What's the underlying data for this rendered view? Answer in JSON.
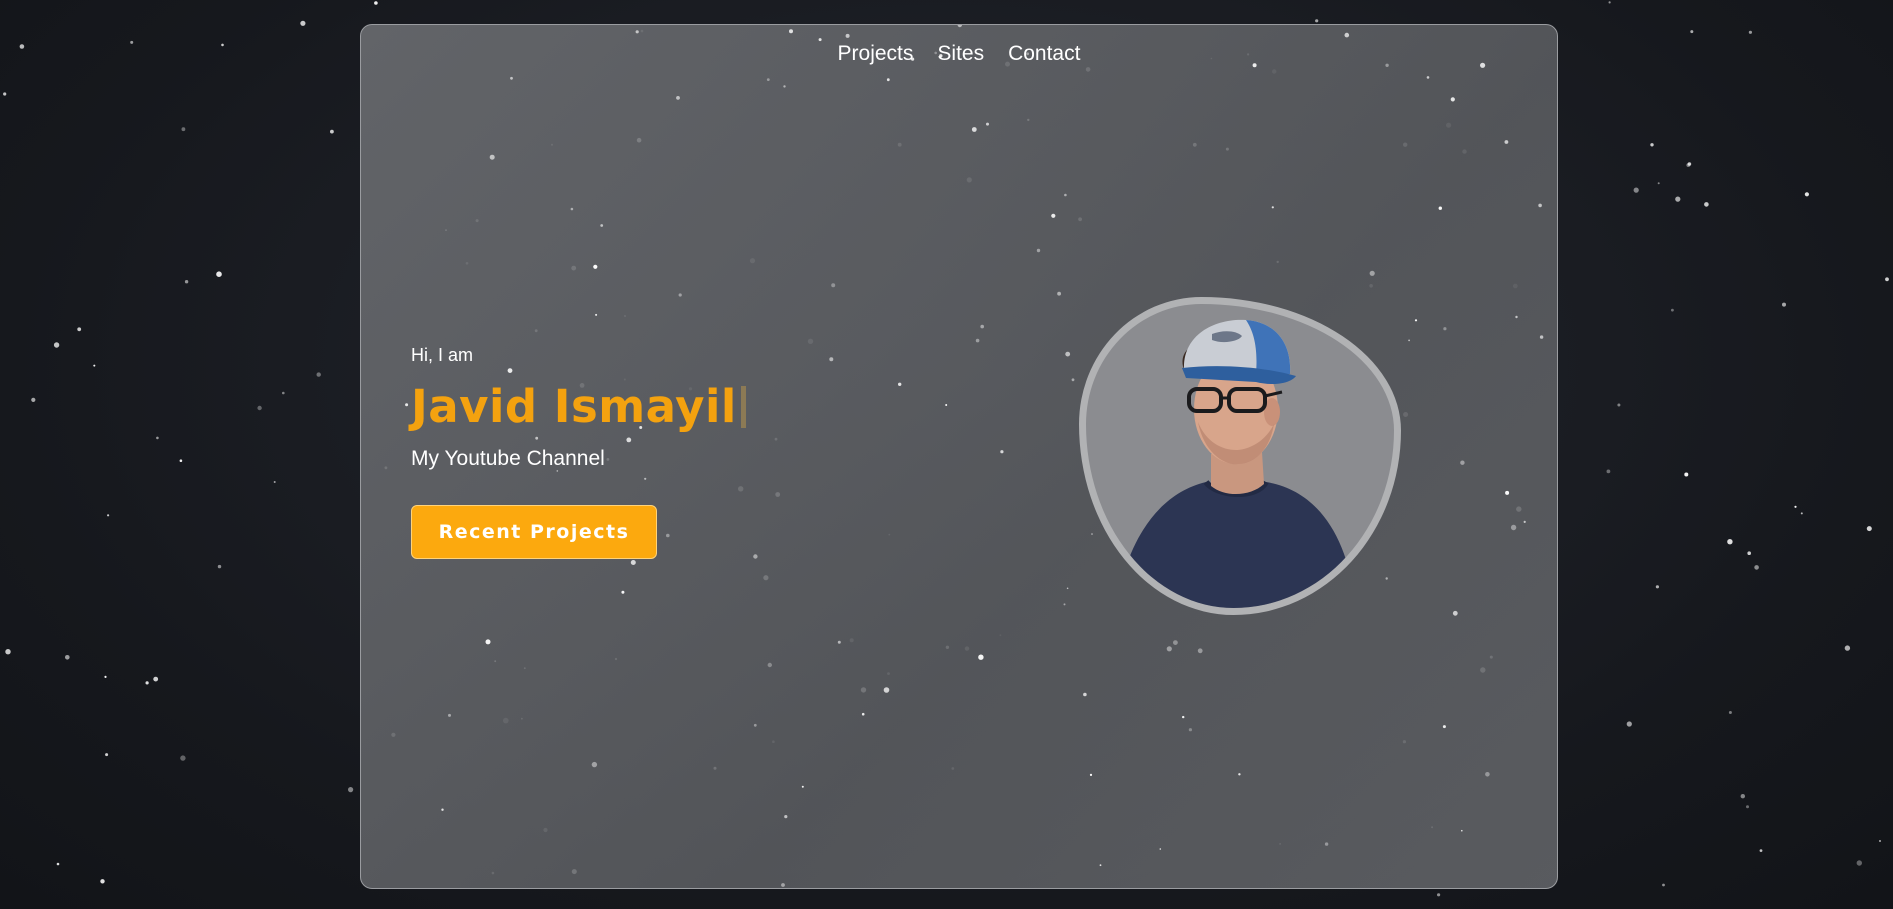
{
  "nav": {
    "items": [
      "Projects",
      "Sites",
      "Contact"
    ]
  },
  "hero": {
    "greeting": "Hi, I am",
    "name": "Javid Ismayil",
    "subtitle": "My Youtube Channel",
    "button_label": "Recent Projects"
  },
  "avatar": {
    "icon": "portrait-photo"
  },
  "colors": {
    "accent": "#fca90e",
    "name": "#f4a20f",
    "background": "#17191e",
    "card": "#5c5e62"
  }
}
